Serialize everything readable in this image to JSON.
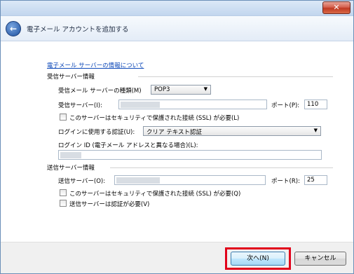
{
  "window": {
    "close_label": "✕"
  },
  "header": {
    "title": "電子メール アカウントを追加する",
    "back_icon": "back-arrow-icon"
  },
  "link": {
    "about": "電子メール サーバーの情報について"
  },
  "incoming": {
    "section_title": "受信サーバー情報",
    "type_label": "受信メール サーバーの種類(M)",
    "type_value": "POP3",
    "server_label": "受信サーバー(I):",
    "port_label": "ポート(P):",
    "port_value": "110",
    "ssl_label": "このサーバーはセキュリティで保護された接続 (SSL) が必要(L)",
    "auth_label": "ログインに使用する認証(U):",
    "auth_value": "クリア テキスト認証",
    "login_label": "ログイン ID (電子メール アドレスと異なる場合)(L):"
  },
  "outgoing": {
    "section_title": "送信サーバー情報",
    "server_label": "送信サーバー(O):",
    "port_label": "ポート(R):",
    "port_value": "25",
    "ssl_label": "このサーバーはセキュリティで保護された接続 (SSL) が必要(Q)",
    "auth_required_label": "送信サーバーは認証が必要(V)"
  },
  "footer": {
    "next_label": "次へ(N)",
    "cancel_label": "キャンセル"
  },
  "colors": {
    "highlight": "#e1001a",
    "link": "#0b47b8"
  }
}
